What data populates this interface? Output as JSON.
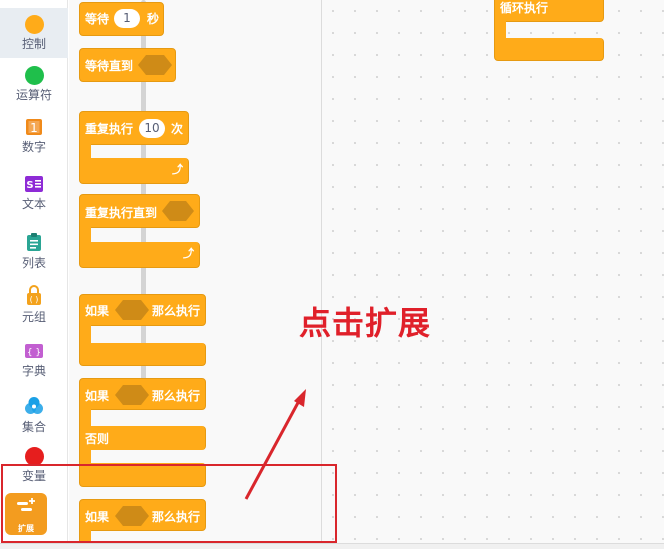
{
  "categories": [
    {
      "label": "控制",
      "icon": "orange-circle-icon",
      "color": "#ffab19",
      "selected": true
    },
    {
      "label": "运算符",
      "icon": "green-circle-icon",
      "color": "#1fbf4b"
    },
    {
      "label": "数字",
      "icon": "number-icon",
      "glyph": "1",
      "color": "#f08a1a"
    },
    {
      "label": "文本",
      "icon": "text-icon",
      "glyph": "S",
      "color": "#8e2bd6"
    },
    {
      "label": "列表",
      "icon": "list-icon",
      "color": "#2aa594"
    },
    {
      "label": "元组",
      "icon": "tuple-icon",
      "glyph": "( )",
      "color": "#f3a21c"
    },
    {
      "label": "字典",
      "icon": "dict-icon",
      "glyph": "{ }",
      "color": "#c25fd1"
    },
    {
      "label": "集合",
      "icon": "set-icon",
      "color": "#1aa0e6"
    },
    {
      "label": "变量",
      "icon": "red-circle-icon",
      "color": "#e61e1e"
    }
  ],
  "extension": {
    "label": "扩展",
    "icon": "extension-icon",
    "color": "#f39c1f"
  },
  "flyout": {
    "wait": {
      "label": "等待",
      "value": "1",
      "unit": "秒"
    },
    "wait_until": {
      "label": "等待直到"
    },
    "repeat": {
      "label": "重复执行",
      "value": "10",
      "unit": "次"
    },
    "repeat_until": {
      "label": "重复执行直到"
    },
    "if_then_1": {
      "label": "如果",
      "then": "那么执行"
    },
    "if_then_else": {
      "label": "如果",
      "then": "那么执行",
      "else": "否则"
    },
    "if_then_2": {
      "label": "如果",
      "then": "那么执行"
    }
  },
  "workspace": {
    "loop_block": {
      "label": "循环执行"
    }
  },
  "annotation": {
    "hint_text": "点击扩展",
    "color": "#e0202a"
  }
}
